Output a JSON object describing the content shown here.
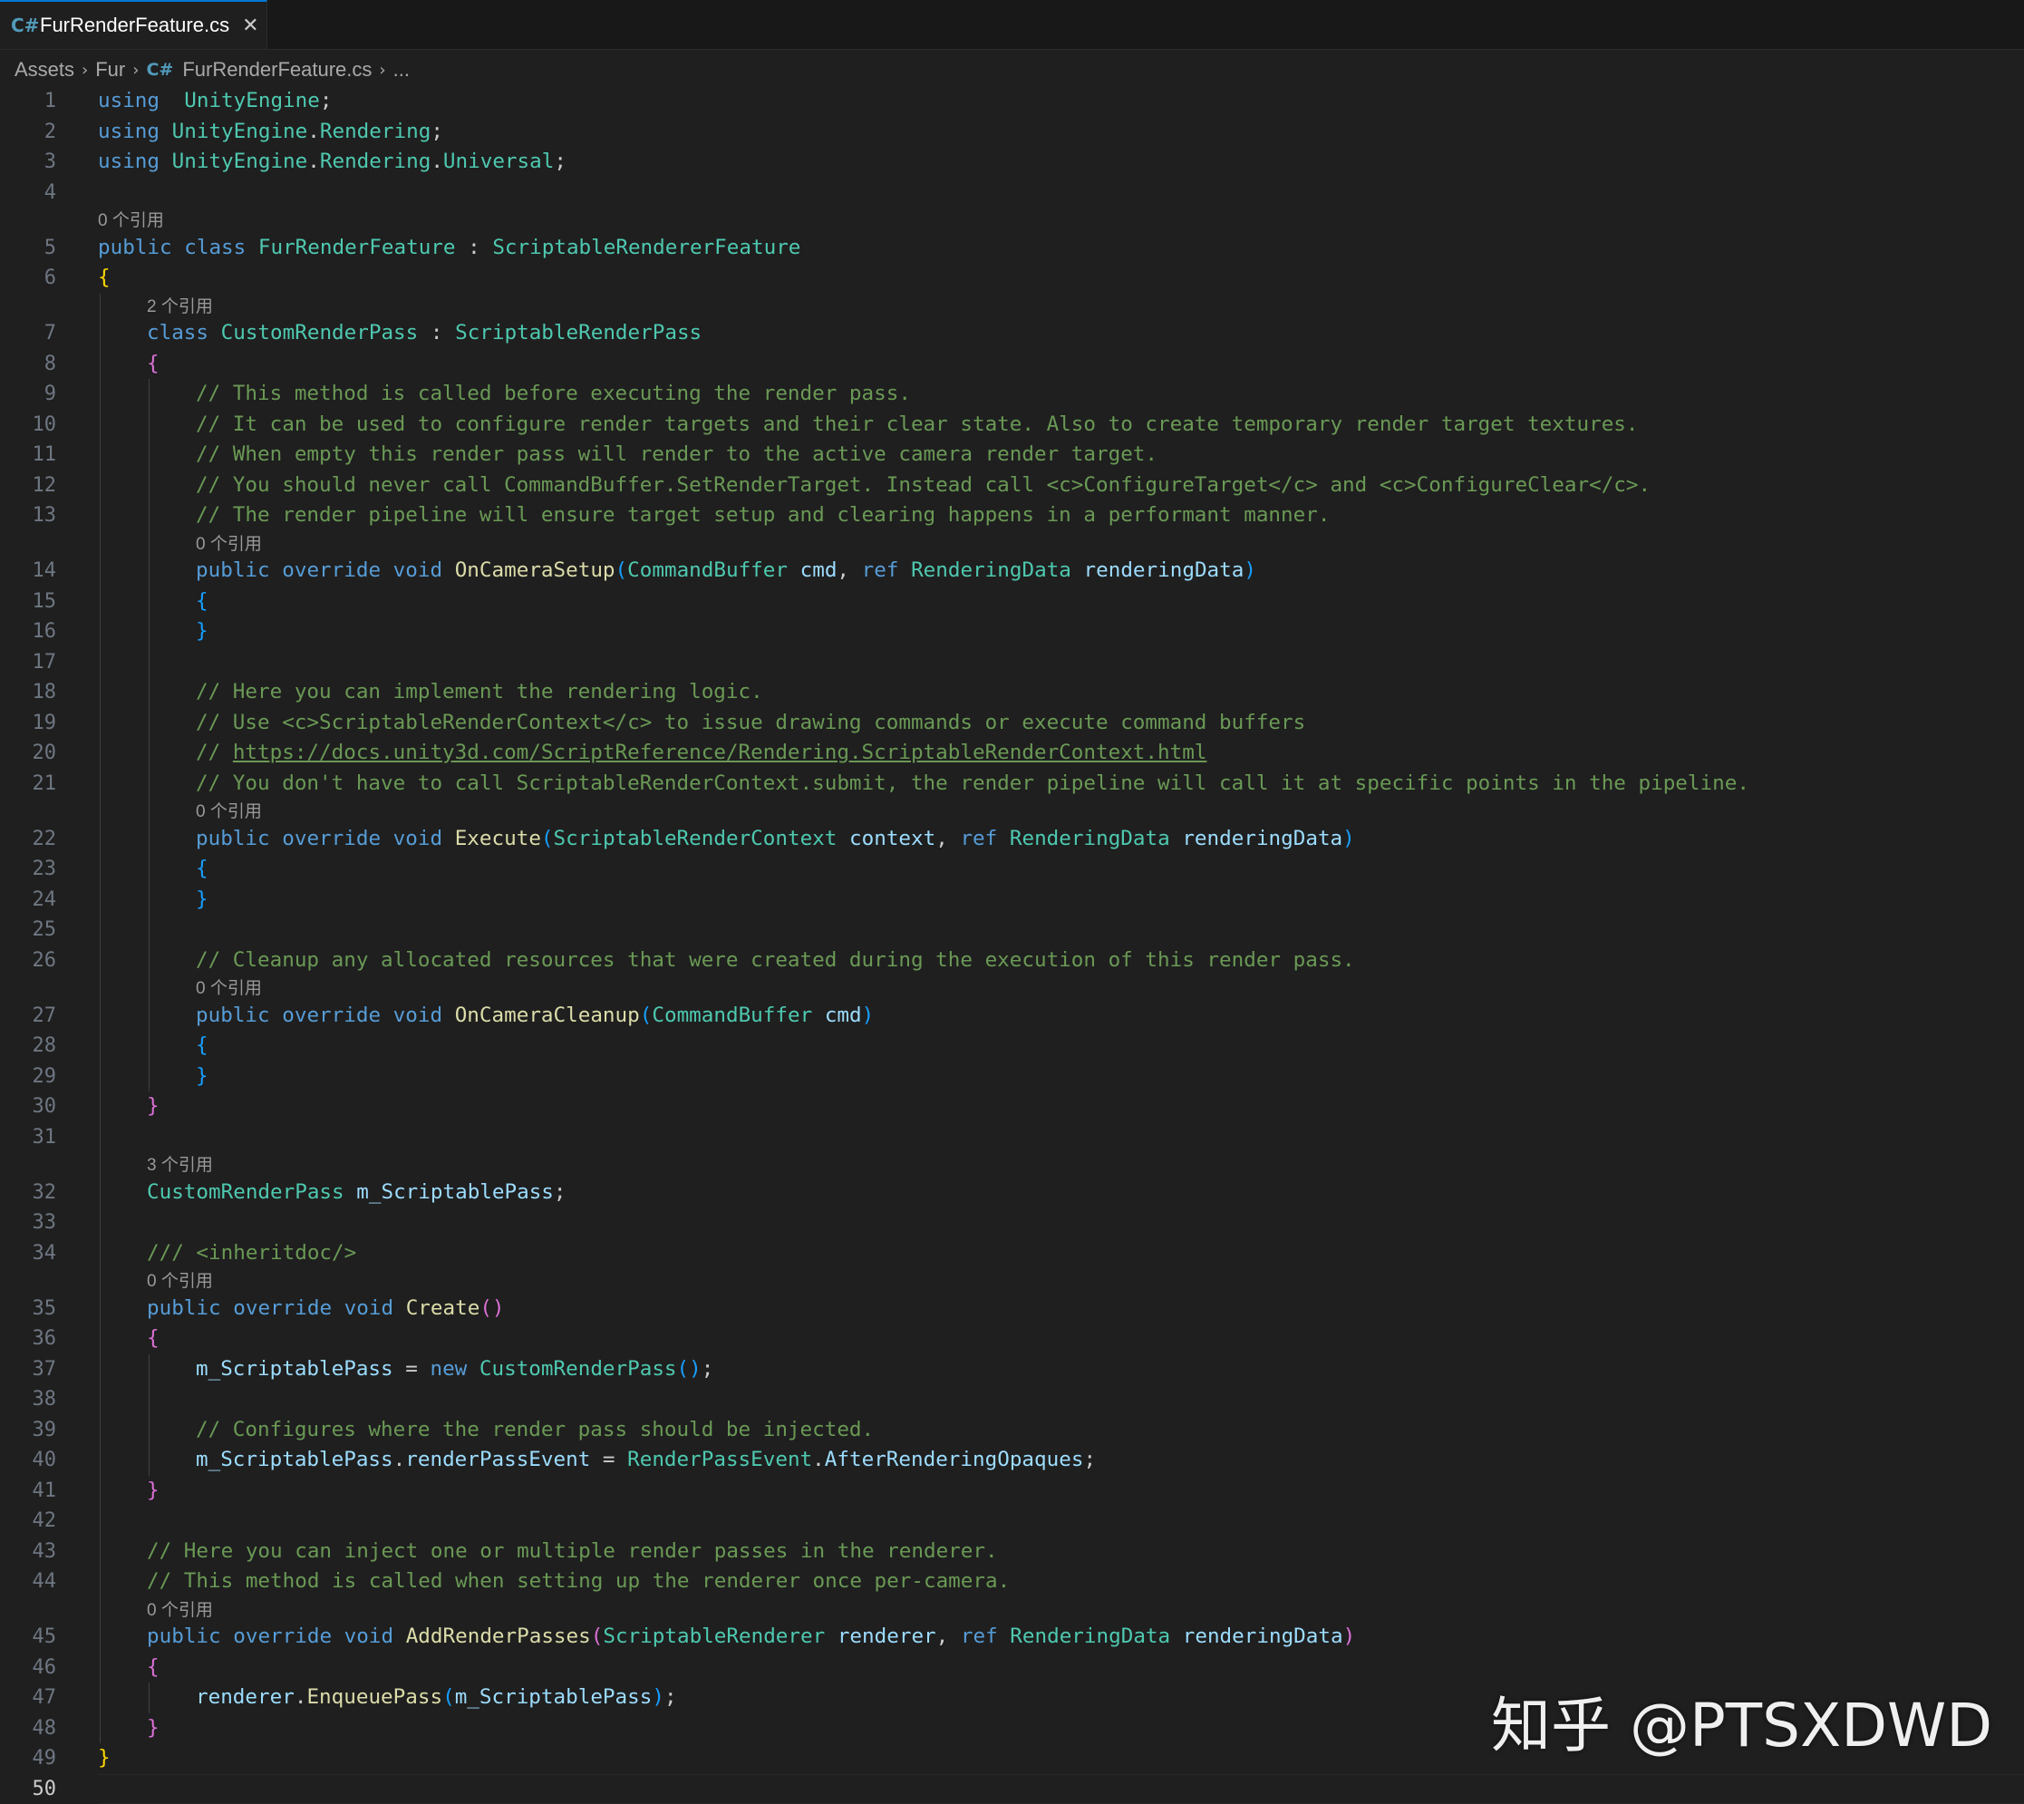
{
  "tab": {
    "icon": "csharp-icon",
    "glyph": "C#",
    "label": "FurRenderFeature.cs",
    "close": "✕"
  },
  "breadcrumb": {
    "assets": "Assets",
    "fur": "Fur",
    "file_icon": "csharp-icon",
    "file": "FurRenderFeature.cs",
    "more": "..."
  },
  "watermark": "知乎 @PTSXDWD",
  "current_line": 50,
  "lines": [
    {
      "n": 1,
      "indent": 0,
      "t": [
        [
          "kw",
          "using"
        ],
        [
          "",
          "  "
        ],
        [
          "ty",
          "UnityEngine"
        ],
        [
          "",
          ";"
        ]
      ]
    },
    {
      "n": 2,
      "indent": 0,
      "t": [
        [
          "kw",
          "using"
        ],
        [
          "",
          " "
        ],
        [
          "ty",
          "UnityEngine"
        ],
        [
          "",
          "."
        ],
        [
          "ty",
          "Rendering"
        ],
        [
          "",
          ";"
        ]
      ]
    },
    {
      "n": 3,
      "indent": 0,
      "t": [
        [
          "kw",
          "using"
        ],
        [
          "",
          " "
        ],
        [
          "ty",
          "UnityEngine"
        ],
        [
          "",
          "."
        ],
        [
          "ty",
          "Rendering"
        ],
        [
          "",
          "."
        ],
        [
          "ty",
          "Universal"
        ],
        [
          "",
          ";"
        ]
      ]
    },
    {
      "n": 4,
      "indent": 0,
      "t": []
    },
    {
      "lens": "0 个引用",
      "indent": 0
    },
    {
      "n": 5,
      "indent": 0,
      "t": [
        [
          "kw",
          "public"
        ],
        [
          "",
          " "
        ],
        [
          "kw",
          "class"
        ],
        [
          "",
          " "
        ],
        [
          "ty",
          "FurRenderFeature"
        ],
        [
          "",
          " : "
        ],
        [
          "ty",
          "ScriptableRendererFeature"
        ]
      ]
    },
    {
      "n": 6,
      "indent": 0,
      "t": [
        [
          "b1",
          "{"
        ]
      ]
    },
    {
      "lens": "2 个引用",
      "indent": 1
    },
    {
      "n": 7,
      "indent": 1,
      "t": [
        [
          "kw",
          "class"
        ],
        [
          "",
          " "
        ],
        [
          "ty",
          "CustomRenderPass"
        ],
        [
          "",
          " : "
        ],
        [
          "ty",
          "ScriptableRenderPass"
        ]
      ]
    },
    {
      "n": 8,
      "indent": 1,
      "t": [
        [
          "b2",
          "{"
        ]
      ]
    },
    {
      "n": 9,
      "indent": 2,
      "t": [
        [
          "cm",
          "// This method is called before executing the render pass."
        ]
      ]
    },
    {
      "n": 10,
      "indent": 2,
      "t": [
        [
          "cm",
          "// It can be used to configure render targets and their clear state. Also to create temporary render target textures."
        ]
      ]
    },
    {
      "n": 11,
      "indent": 2,
      "t": [
        [
          "cm",
          "// When empty this render pass will render to the active camera render target."
        ]
      ]
    },
    {
      "n": 12,
      "indent": 2,
      "t": [
        [
          "cm",
          "// You should never call CommandBuffer.SetRenderTarget. Instead call <c>ConfigureTarget</c> and <c>ConfigureClear</c>."
        ]
      ]
    },
    {
      "n": 13,
      "indent": 2,
      "t": [
        [
          "cm",
          "// The render pipeline will ensure target setup and clearing happens in a performant manner."
        ]
      ]
    },
    {
      "lens": "0 个引用",
      "indent": 2
    },
    {
      "n": 14,
      "indent": 2,
      "t": [
        [
          "kw",
          "public"
        ],
        [
          "",
          " "
        ],
        [
          "kw",
          "override"
        ],
        [
          "",
          " "
        ],
        [
          "kw",
          "void"
        ],
        [
          "",
          " "
        ],
        [
          "fn",
          "OnCameraSetup"
        ],
        [
          "b3",
          "("
        ],
        [
          "ty",
          "CommandBuffer"
        ],
        [
          "",
          " "
        ],
        [
          "pm",
          "cmd"
        ],
        [
          "",
          ", "
        ],
        [
          "kw",
          "ref"
        ],
        [
          "",
          " "
        ],
        [
          "ty",
          "RenderingData"
        ],
        [
          "",
          " "
        ],
        [
          "pm",
          "renderingData"
        ],
        [
          "b3",
          ")"
        ]
      ]
    },
    {
      "n": 15,
      "indent": 2,
      "t": [
        [
          "b3",
          "{"
        ]
      ]
    },
    {
      "n": 16,
      "indent": 2,
      "t": [
        [
          "b3",
          "}"
        ]
      ]
    },
    {
      "n": 17,
      "indent": 2,
      "t": []
    },
    {
      "n": 18,
      "indent": 2,
      "t": [
        [
          "cm",
          "// Here you can implement the rendering logic."
        ]
      ]
    },
    {
      "n": 19,
      "indent": 2,
      "t": [
        [
          "cm",
          "// Use <c>ScriptableRenderContext</c> to issue drawing commands or execute command buffers"
        ]
      ]
    },
    {
      "n": 20,
      "indent": 2,
      "t": [
        [
          "cm",
          "// "
        ],
        [
          "lk",
          "https://docs.unity3d.com/ScriptReference/Rendering.ScriptableRenderContext.html"
        ]
      ]
    },
    {
      "n": 21,
      "indent": 2,
      "t": [
        [
          "cm",
          "// You don't have to call ScriptableRenderContext.submit, the render pipeline will call it at specific points in the pipeline."
        ]
      ]
    },
    {
      "lens": "0 个引用",
      "indent": 2
    },
    {
      "n": 22,
      "indent": 2,
      "t": [
        [
          "kw",
          "public"
        ],
        [
          "",
          " "
        ],
        [
          "kw",
          "override"
        ],
        [
          "",
          " "
        ],
        [
          "kw",
          "void"
        ],
        [
          "",
          " "
        ],
        [
          "fn",
          "Execute"
        ],
        [
          "b3",
          "("
        ],
        [
          "ty",
          "ScriptableRenderContext"
        ],
        [
          "",
          " "
        ],
        [
          "pm",
          "context"
        ],
        [
          "",
          ", "
        ],
        [
          "kw",
          "ref"
        ],
        [
          "",
          " "
        ],
        [
          "ty",
          "RenderingData"
        ],
        [
          "",
          " "
        ],
        [
          "pm",
          "renderingData"
        ],
        [
          "b3",
          ")"
        ]
      ]
    },
    {
      "n": 23,
      "indent": 2,
      "t": [
        [
          "b3",
          "{"
        ]
      ]
    },
    {
      "n": 24,
      "indent": 2,
      "t": [
        [
          "b3",
          "}"
        ]
      ]
    },
    {
      "n": 25,
      "indent": 2,
      "t": []
    },
    {
      "n": 26,
      "indent": 2,
      "t": [
        [
          "cm",
          "// Cleanup any allocated resources that were created during the execution of this render pass."
        ]
      ]
    },
    {
      "lens": "0 个引用",
      "indent": 2
    },
    {
      "n": 27,
      "indent": 2,
      "t": [
        [
          "kw",
          "public"
        ],
        [
          "",
          " "
        ],
        [
          "kw",
          "override"
        ],
        [
          "",
          " "
        ],
        [
          "kw",
          "void"
        ],
        [
          "",
          " "
        ],
        [
          "fn",
          "OnCameraCleanup"
        ],
        [
          "b3",
          "("
        ],
        [
          "ty",
          "CommandBuffer"
        ],
        [
          "",
          " "
        ],
        [
          "pm",
          "cmd"
        ],
        [
          "b3",
          ")"
        ]
      ]
    },
    {
      "n": 28,
      "indent": 2,
      "t": [
        [
          "b3",
          "{"
        ]
      ]
    },
    {
      "n": 29,
      "indent": 2,
      "t": [
        [
          "b3",
          "}"
        ]
      ]
    },
    {
      "n": 30,
      "indent": 1,
      "t": [
        [
          "b2",
          "}"
        ]
      ]
    },
    {
      "n": 31,
      "indent": 1,
      "t": []
    },
    {
      "lens": "3 个引用",
      "indent": 1
    },
    {
      "n": 32,
      "indent": 1,
      "t": [
        [
          "ty",
          "CustomRenderPass"
        ],
        [
          "",
          " "
        ],
        [
          "pm",
          "m_ScriptablePass"
        ],
        [
          "",
          ";"
        ]
      ]
    },
    {
      "n": 33,
      "indent": 1,
      "t": []
    },
    {
      "n": 34,
      "indent": 1,
      "t": [
        [
          "cm",
          "/// <inheritdoc/>"
        ]
      ]
    },
    {
      "lens": "0 个引用",
      "indent": 1
    },
    {
      "n": 35,
      "indent": 1,
      "t": [
        [
          "kw",
          "public"
        ],
        [
          "",
          " "
        ],
        [
          "kw",
          "override"
        ],
        [
          "",
          " "
        ],
        [
          "kw",
          "void"
        ],
        [
          "",
          " "
        ],
        [
          "fn",
          "Create"
        ],
        [
          "b2",
          "()"
        ]
      ]
    },
    {
      "n": 36,
      "indent": 1,
      "t": [
        [
          "b2",
          "{"
        ]
      ]
    },
    {
      "n": 37,
      "indent": 2,
      "t": [
        [
          "pm",
          "m_ScriptablePass"
        ],
        [
          "",
          " = "
        ],
        [
          "kw",
          "new"
        ],
        [
          "",
          " "
        ],
        [
          "ty",
          "CustomRenderPass"
        ],
        [
          "b3",
          "()"
        ],
        [
          "",
          ";"
        ]
      ]
    },
    {
      "n": 38,
      "indent": 2,
      "t": []
    },
    {
      "n": 39,
      "indent": 2,
      "t": [
        [
          "cm",
          "// Configures where the render pass should be injected."
        ]
      ]
    },
    {
      "n": 40,
      "indent": 2,
      "t": [
        [
          "pm",
          "m_ScriptablePass"
        ],
        [
          "",
          "."
        ],
        [
          "pm",
          "renderPassEvent"
        ],
        [
          "",
          " = "
        ],
        [
          "ty",
          "RenderPassEvent"
        ],
        [
          "",
          "."
        ],
        [
          "pm",
          "AfterRenderingOpaques"
        ],
        [
          "",
          ";"
        ]
      ]
    },
    {
      "n": 41,
      "indent": 1,
      "t": [
        [
          "b2",
          "}"
        ]
      ]
    },
    {
      "n": 42,
      "indent": 1,
      "t": []
    },
    {
      "n": 43,
      "indent": 1,
      "t": [
        [
          "cm",
          "// Here you can inject one or multiple render passes in the renderer."
        ]
      ]
    },
    {
      "n": 44,
      "indent": 1,
      "t": [
        [
          "cm",
          "// This method is called when setting up the renderer once per-camera."
        ]
      ]
    },
    {
      "lens": "0 个引用",
      "indent": 1
    },
    {
      "n": 45,
      "indent": 1,
      "t": [
        [
          "kw",
          "public"
        ],
        [
          "",
          " "
        ],
        [
          "kw",
          "override"
        ],
        [
          "",
          " "
        ],
        [
          "kw",
          "void"
        ],
        [
          "",
          " "
        ],
        [
          "fn",
          "AddRenderPasses"
        ],
        [
          "b2",
          "("
        ],
        [
          "ty",
          "ScriptableRenderer"
        ],
        [
          "",
          " "
        ],
        [
          "pm",
          "renderer"
        ],
        [
          "",
          ", "
        ],
        [
          "kw",
          "ref"
        ],
        [
          "",
          " "
        ],
        [
          "ty",
          "RenderingData"
        ],
        [
          "",
          " "
        ],
        [
          "pm",
          "renderingData"
        ],
        [
          "b2",
          ")"
        ]
      ]
    },
    {
      "n": 46,
      "indent": 1,
      "t": [
        [
          "b2",
          "{"
        ]
      ]
    },
    {
      "n": 47,
      "indent": 2,
      "t": [
        [
          "pm",
          "renderer"
        ],
        [
          "",
          "."
        ],
        [
          "fn",
          "EnqueuePass"
        ],
        [
          "b3",
          "("
        ],
        [
          "pm",
          "m_ScriptablePass"
        ],
        [
          "b3",
          ")"
        ],
        [
          "",
          ";"
        ]
      ]
    },
    {
      "n": 48,
      "indent": 1,
      "t": [
        [
          "b2",
          "}"
        ]
      ]
    },
    {
      "n": 49,
      "indent": 0,
      "t": [
        [
          "b1",
          "}"
        ]
      ]
    },
    {
      "n": 50,
      "indent": 0,
      "t": []
    }
  ],
  "colors": {
    "background": "#1f1f1f",
    "keyword": "#569cd6",
    "type": "#4ec9b0",
    "function": "#dcdcaa",
    "variable": "#9cdcfe",
    "comment": "#6a9955",
    "bracket_1": "#ffd700",
    "bracket_2": "#da70d6",
    "bracket_3": "#179fff"
  }
}
